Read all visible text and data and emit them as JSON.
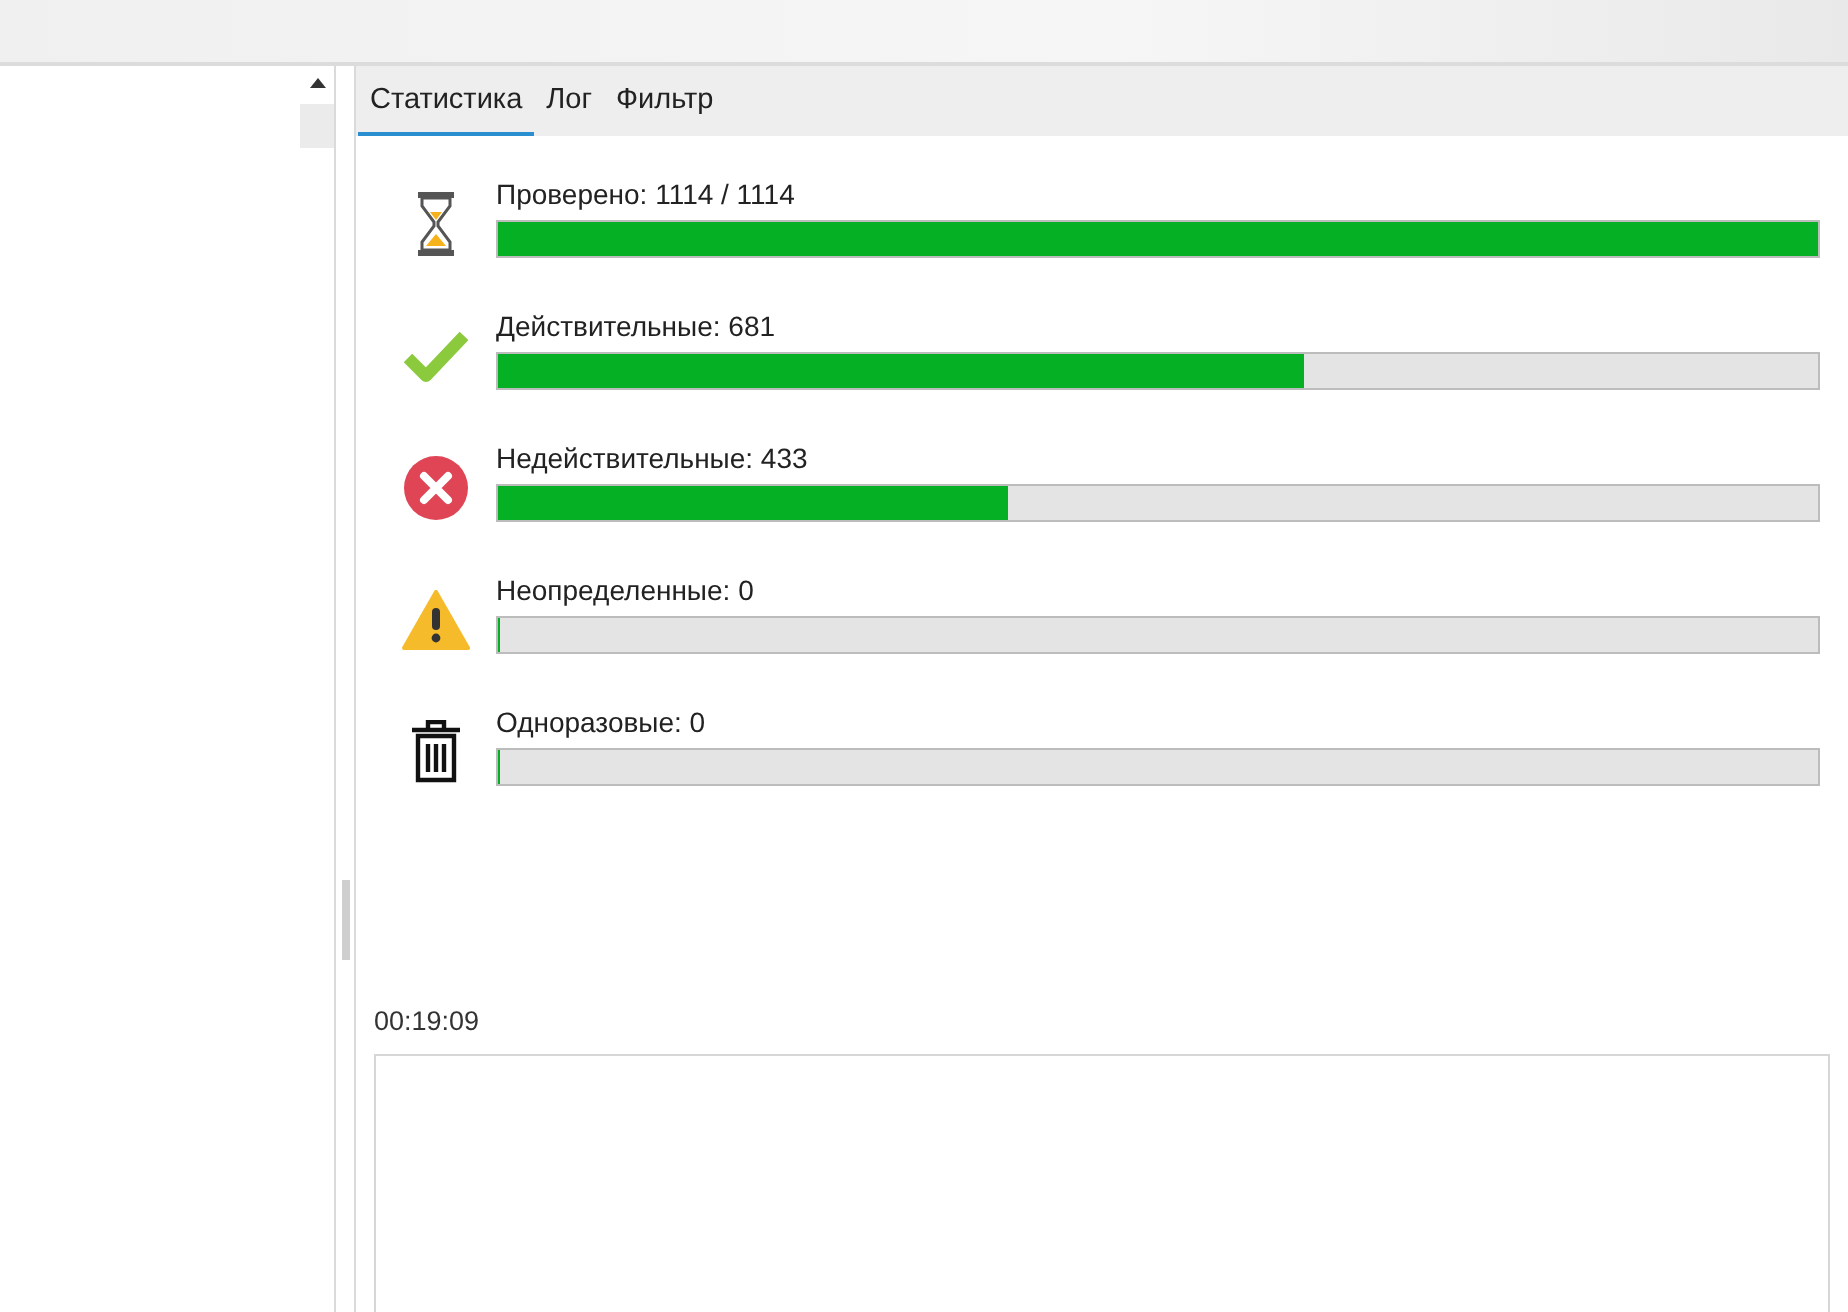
{
  "tabs": [
    {
      "label": "Статистика",
      "selected": true
    },
    {
      "label": "Лог",
      "selected": false
    },
    {
      "label": "Фильтр",
      "selected": false
    }
  ],
  "stats": [
    {
      "kind": "hourglass",
      "label": "Проверено: 1114 / 1114",
      "level": 1.0
    },
    {
      "kind": "check",
      "label": "Действительные: 681",
      "level": 0.611
    },
    {
      "kind": "error",
      "label": "Недействительные: 433",
      "level": 0.387
    },
    {
      "kind": "warning",
      "label": "Неопределенные: 0",
      "level": 0
    },
    {
      "kind": "trash",
      "label": "Одноразовые: 0",
      "level": 0
    }
  ],
  "elapsed": "00:19:09"
}
